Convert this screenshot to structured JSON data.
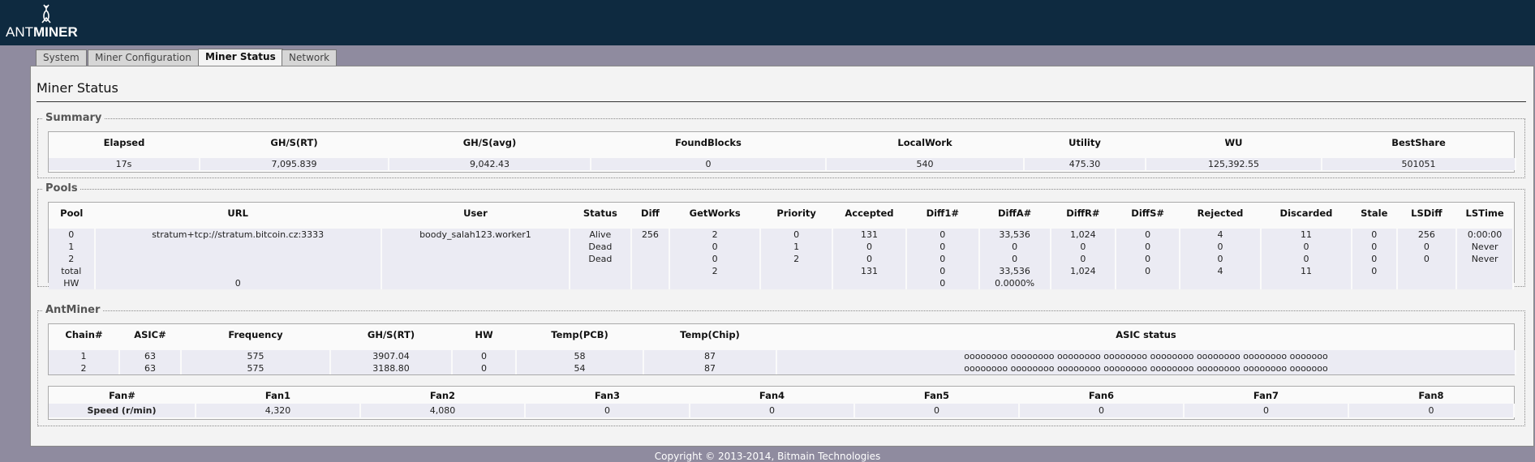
{
  "header": {
    "logo_prefix": "ANT",
    "logo_suffix": "MINER"
  },
  "tabs": [
    {
      "label": "System"
    },
    {
      "label": "Miner Configuration"
    },
    {
      "label": "Miner Status",
      "active": true
    },
    {
      "label": "Network"
    }
  ],
  "page": {
    "title": "Miner Status"
  },
  "summary": {
    "legend": "Summary",
    "headers": [
      "Elapsed",
      "GH/S(RT)",
      "GH/S(avg)",
      "FoundBlocks",
      "LocalWork",
      "Utility",
      "WU",
      "BestShare"
    ],
    "row": [
      "17s",
      "7,095.839",
      "9,042.43",
      "0",
      "540",
      "475.30",
      "125,392.55",
      "501051"
    ]
  },
  "pools": {
    "legend": "Pools",
    "headers": [
      "Pool",
      "URL",
      "User",
      "Status",
      "Diff",
      "GetWorks",
      "Priority",
      "Accepted",
      "Diff1#",
      "DiffA#",
      "DiffR#",
      "DiffS#",
      "Rejected",
      "Discarded",
      "Stale",
      "LSDiff",
      "LSTime"
    ],
    "rows": [
      [
        "0",
        "stratum+tcp://stratum.bitcoin.cz:3333",
        "boody_salah123.worker1",
        "Alive",
        "256",
        "2",
        "0",
        "131",
        "0",
        "33,536",
        "1,024",
        "0",
        "4",
        "11",
        "0",
        "256",
        "0:00:00"
      ],
      [
        "1",
        "",
        "",
        "Dead",
        "",
        "0",
        "1",
        "0",
        "0",
        "0",
        "0",
        "0",
        "0",
        "0",
        "0",
        "0",
        "Never"
      ],
      [
        "2",
        "",
        "",
        "Dead",
        "",
        "0",
        "2",
        "0",
        "0",
        "0",
        "0",
        "0",
        "0",
        "0",
        "0",
        "0",
        "Never"
      ],
      [
        "total",
        "",
        "",
        "",
        "",
        "2",
        "",
        "131",
        "0",
        "33,536",
        "1,024",
        "0",
        "4",
        "11",
        "0",
        "",
        ""
      ]
    ],
    "hw_row": {
      "label": "HW",
      "value": "0",
      "diff1": "0",
      "diffa": "0.0000%"
    }
  },
  "antminer": {
    "legend": "AntMiner",
    "headers": [
      "Chain#",
      "ASIC#",
      "Frequency",
      "GH/S(RT)",
      "HW",
      "Temp(PCB)",
      "Temp(Chip)",
      "ASIC status"
    ],
    "rows": [
      [
        "1",
        "63",
        "575",
        "3907.04",
        "0",
        "58",
        "87",
        "oooooooo oooooooo oooooooo oooooooo oooooooo oooooooo oooooooo ooooooo"
      ],
      [
        "2",
        "63",
        "575",
        "3188.80",
        "0",
        "54",
        "87",
        "oooooooo oooooooo oooooooo oooooooo oooooooo oooooooo oooooooo ooooooo"
      ]
    ]
  },
  "fans": {
    "headers": [
      "Fan#",
      "Fan1",
      "Fan2",
      "Fan3",
      "Fan4",
      "Fan5",
      "Fan6",
      "Fan7",
      "Fan8"
    ],
    "row": [
      "Speed (r/min)",
      "4,320",
      "4,080",
      "0",
      "0",
      "0",
      "0",
      "0",
      "0"
    ]
  },
  "footer": {
    "copyright": "Copyright © 2013-2014, Bitmain Technologies"
  }
}
